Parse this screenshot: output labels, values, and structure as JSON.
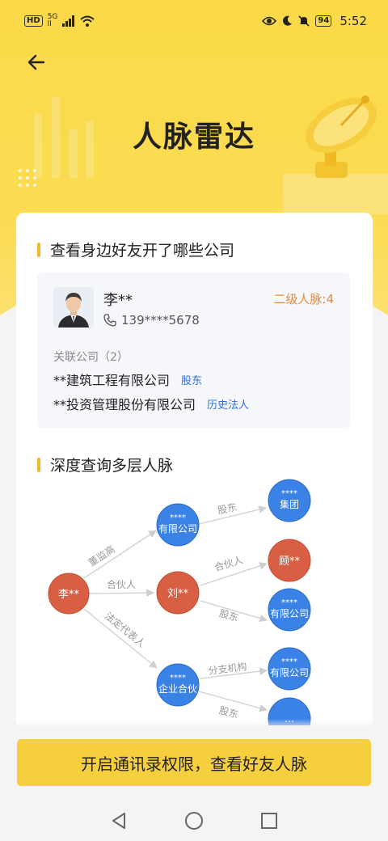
{
  "status_bar": {
    "hd": "HD",
    "net_top": "5G",
    "net_bottom": "ll",
    "battery": "94",
    "time": "5:52"
  },
  "header": {
    "title": "人脉雷达"
  },
  "colors": {
    "accent_yellow": "#f6cf3f",
    "node_blue": "#3b82e6",
    "node_red": "#d85f43",
    "tag_blue": "#2f6fd6",
    "level_orange": "#e88a3c"
  },
  "friends_section": {
    "title": "查看身边好友开了哪些公司",
    "friend": {
      "name": "李**",
      "phone": "139****5678",
      "network_level": "二级人脉:4",
      "related_label": "关联公司（2）",
      "companies": [
        {
          "name": "**建筑工程有限公司",
          "tag": "股东"
        },
        {
          "name": "**投资管理股份有限公司",
          "tag": "历史法人"
        }
      ]
    }
  },
  "graph_section": {
    "title": "深度查询多层人脉",
    "nodes": {
      "root": "李**",
      "company_a": {
        "top": "****",
        "bottom": "有限公司"
      },
      "person_liu": "刘**",
      "partnership": {
        "top": "****",
        "bottom": "企业合伙"
      },
      "group": {
        "top": "****",
        "bottom": "集团"
      },
      "person_gu": "顾**",
      "company_b": {
        "top": "****",
        "bottom": "有限公司"
      },
      "company_c": {
        "top": "****",
        "bottom": "有限公司"
      },
      "more": "..."
    },
    "edges": {
      "executive": "董监高",
      "partner": "合伙人",
      "legal_rep": "法定代表人",
      "shareholder_1": "股东",
      "partner_2": "合伙人",
      "shareholder_2": "股东",
      "branch": "分支机构",
      "shareholder_3": "股东"
    }
  },
  "cta": {
    "label": "开启通讯录权限，查看好友人脉"
  },
  "icons": [
    "back-arrow-icon",
    "phone-icon",
    "eye-icon",
    "moon-icon",
    "mute-bell-icon",
    "wifi-icon",
    "signal-icon",
    "nav-back-icon",
    "nav-home-icon",
    "nav-recents-icon"
  ]
}
